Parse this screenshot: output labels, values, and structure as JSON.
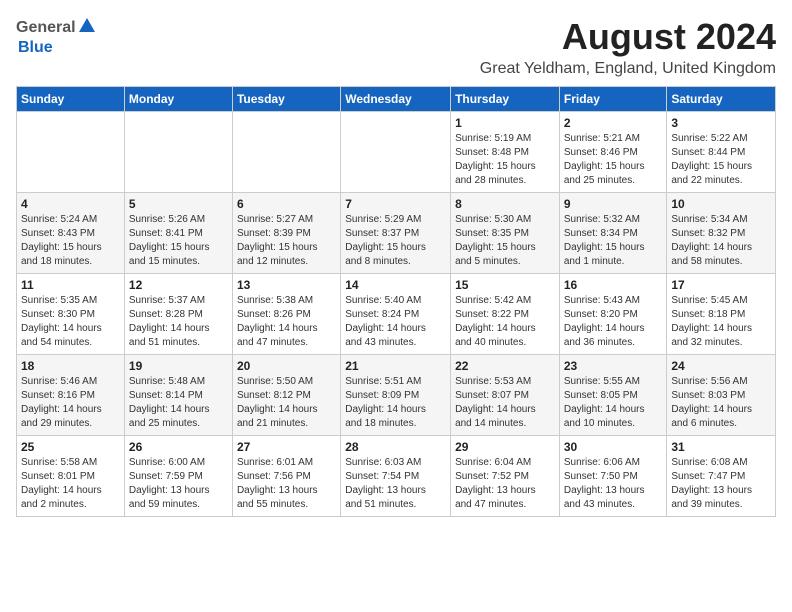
{
  "header": {
    "logo_general": "General",
    "logo_blue": "Blue",
    "month_year": "August 2024",
    "location": "Great Yeldham, England, United Kingdom"
  },
  "columns": [
    "Sunday",
    "Monday",
    "Tuesday",
    "Wednesday",
    "Thursday",
    "Friday",
    "Saturday"
  ],
  "weeks": [
    [
      {
        "day": "",
        "info": ""
      },
      {
        "day": "",
        "info": ""
      },
      {
        "day": "",
        "info": ""
      },
      {
        "day": "",
        "info": ""
      },
      {
        "day": "1",
        "info": "Sunrise: 5:19 AM\nSunset: 8:48 PM\nDaylight: 15 hours\nand 28 minutes."
      },
      {
        "day": "2",
        "info": "Sunrise: 5:21 AM\nSunset: 8:46 PM\nDaylight: 15 hours\nand 25 minutes."
      },
      {
        "day": "3",
        "info": "Sunrise: 5:22 AM\nSunset: 8:44 PM\nDaylight: 15 hours\nand 22 minutes."
      }
    ],
    [
      {
        "day": "4",
        "info": "Sunrise: 5:24 AM\nSunset: 8:43 PM\nDaylight: 15 hours\nand 18 minutes."
      },
      {
        "day": "5",
        "info": "Sunrise: 5:26 AM\nSunset: 8:41 PM\nDaylight: 15 hours\nand 15 minutes."
      },
      {
        "day": "6",
        "info": "Sunrise: 5:27 AM\nSunset: 8:39 PM\nDaylight: 15 hours\nand 12 minutes."
      },
      {
        "day": "7",
        "info": "Sunrise: 5:29 AM\nSunset: 8:37 PM\nDaylight: 15 hours\nand 8 minutes."
      },
      {
        "day": "8",
        "info": "Sunrise: 5:30 AM\nSunset: 8:35 PM\nDaylight: 15 hours\nand 5 minutes."
      },
      {
        "day": "9",
        "info": "Sunrise: 5:32 AM\nSunset: 8:34 PM\nDaylight: 15 hours\nand 1 minute."
      },
      {
        "day": "10",
        "info": "Sunrise: 5:34 AM\nSunset: 8:32 PM\nDaylight: 14 hours\nand 58 minutes."
      }
    ],
    [
      {
        "day": "11",
        "info": "Sunrise: 5:35 AM\nSunset: 8:30 PM\nDaylight: 14 hours\nand 54 minutes."
      },
      {
        "day": "12",
        "info": "Sunrise: 5:37 AM\nSunset: 8:28 PM\nDaylight: 14 hours\nand 51 minutes."
      },
      {
        "day": "13",
        "info": "Sunrise: 5:38 AM\nSunset: 8:26 PM\nDaylight: 14 hours\nand 47 minutes."
      },
      {
        "day": "14",
        "info": "Sunrise: 5:40 AM\nSunset: 8:24 PM\nDaylight: 14 hours\nand 43 minutes."
      },
      {
        "day": "15",
        "info": "Sunrise: 5:42 AM\nSunset: 8:22 PM\nDaylight: 14 hours\nand 40 minutes."
      },
      {
        "day": "16",
        "info": "Sunrise: 5:43 AM\nSunset: 8:20 PM\nDaylight: 14 hours\nand 36 minutes."
      },
      {
        "day": "17",
        "info": "Sunrise: 5:45 AM\nSunset: 8:18 PM\nDaylight: 14 hours\nand 32 minutes."
      }
    ],
    [
      {
        "day": "18",
        "info": "Sunrise: 5:46 AM\nSunset: 8:16 PM\nDaylight: 14 hours\nand 29 minutes."
      },
      {
        "day": "19",
        "info": "Sunrise: 5:48 AM\nSunset: 8:14 PM\nDaylight: 14 hours\nand 25 minutes."
      },
      {
        "day": "20",
        "info": "Sunrise: 5:50 AM\nSunset: 8:12 PM\nDaylight: 14 hours\nand 21 minutes."
      },
      {
        "day": "21",
        "info": "Sunrise: 5:51 AM\nSunset: 8:09 PM\nDaylight: 14 hours\nand 18 minutes."
      },
      {
        "day": "22",
        "info": "Sunrise: 5:53 AM\nSunset: 8:07 PM\nDaylight: 14 hours\nand 14 minutes."
      },
      {
        "day": "23",
        "info": "Sunrise: 5:55 AM\nSunset: 8:05 PM\nDaylight: 14 hours\nand 10 minutes."
      },
      {
        "day": "24",
        "info": "Sunrise: 5:56 AM\nSunset: 8:03 PM\nDaylight: 14 hours\nand 6 minutes."
      }
    ],
    [
      {
        "day": "25",
        "info": "Sunrise: 5:58 AM\nSunset: 8:01 PM\nDaylight: 14 hours\nand 2 minutes."
      },
      {
        "day": "26",
        "info": "Sunrise: 6:00 AM\nSunset: 7:59 PM\nDaylight: 13 hours\nand 59 minutes."
      },
      {
        "day": "27",
        "info": "Sunrise: 6:01 AM\nSunset: 7:56 PM\nDaylight: 13 hours\nand 55 minutes."
      },
      {
        "day": "28",
        "info": "Sunrise: 6:03 AM\nSunset: 7:54 PM\nDaylight: 13 hours\nand 51 minutes."
      },
      {
        "day": "29",
        "info": "Sunrise: 6:04 AM\nSunset: 7:52 PM\nDaylight: 13 hours\nand 47 minutes."
      },
      {
        "day": "30",
        "info": "Sunrise: 6:06 AM\nSunset: 7:50 PM\nDaylight: 13 hours\nand 43 minutes."
      },
      {
        "day": "31",
        "info": "Sunrise: 6:08 AM\nSunset: 7:47 PM\nDaylight: 13 hours\nand 39 minutes."
      }
    ]
  ]
}
